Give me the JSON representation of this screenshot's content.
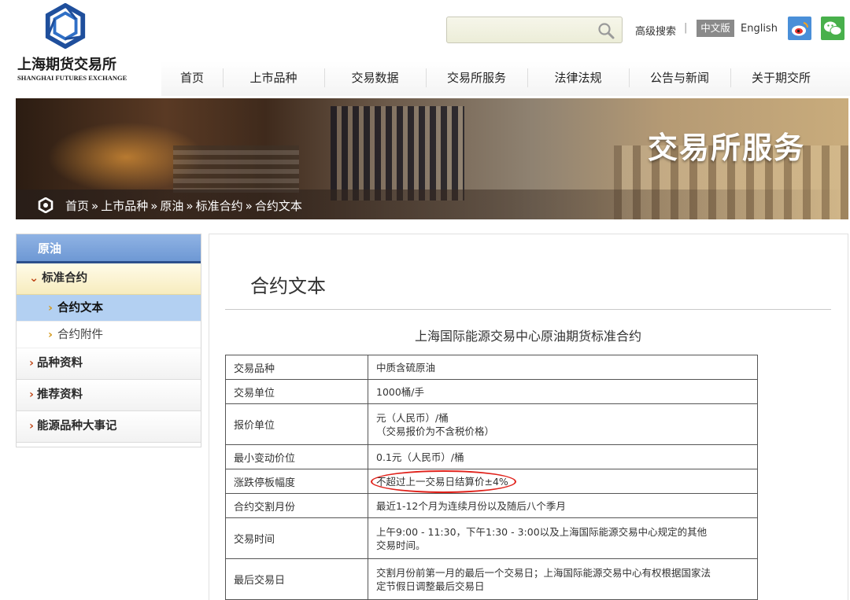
{
  "header": {
    "logo_cn": "上海期货交易所",
    "logo_en": "SHANGHAI FUTURES EXCHANGE",
    "search_placeholder": "",
    "advanced_search": "高级搜索",
    "separator": "|",
    "lang_cn": "中文版",
    "lang_en": "English"
  },
  "nav": [
    {
      "label": "首页"
    },
    {
      "label": "上市品种"
    },
    {
      "label": "交易数据"
    },
    {
      "label": "交易所服务"
    },
    {
      "label": "法律法规"
    },
    {
      "label": "公告与新闻"
    },
    {
      "label": "关于期交所"
    }
  ],
  "banner": {
    "title": "交易所服务",
    "breadcrumb": [
      "首页",
      "上市品种",
      "原油",
      "标准合约",
      "合约文本"
    ],
    "crumb_sep": "»"
  },
  "sidebar": {
    "head": "原油",
    "group": "标准合约",
    "group_chevron": "⌄",
    "subs": [
      {
        "label": "合约文本",
        "active": true
      },
      {
        "label": "合约附件",
        "active": false
      }
    ],
    "sub_chevron": "›",
    "items": [
      {
        "label": "品种资料"
      },
      {
        "label": "推荐资料"
      },
      {
        "label": "能源品种大事记"
      }
    ],
    "item_chevron": "›"
  },
  "main": {
    "title": "合约文本",
    "doc_title": "上海国际能源交易中心原油期货标准合约",
    "rows": [
      {
        "key": "交易品种",
        "value": [
          "中质含硫原油"
        ]
      },
      {
        "key": "交易单位",
        "value": [
          "1000桶/手"
        ]
      },
      {
        "key": "报价单位",
        "value": [
          "元（人民币）/桶",
          "（交易报价为不含税价格）"
        ]
      },
      {
        "key": "最小变动价位",
        "value": [
          "0.1元（人民币）/桶"
        ]
      },
      {
        "key": "涨跌停板幅度",
        "value": [
          "不超过上一交易日结算价±4%"
        ],
        "highlighted": true
      },
      {
        "key": "合约交割月份",
        "value": [
          "最近1-12个月为连续月份以及随后八个季月"
        ]
      },
      {
        "key": "交易时间",
        "value": [
          "上午9:00 - 11:30，下午1:30 - 3:00以及上海国际能源交易中心规定的其他",
          "交易时间。"
        ]
      },
      {
        "key": "最后交易日",
        "value": [
          "交割月份前第一月的最后一个交易日；上海国际能源交易中心有权根据国家法",
          "定节假日调整最后交易日"
        ]
      }
    ]
  },
  "colors": {
    "nav_active_blue": "#2c4f8c",
    "sidebar_active": "#b3d0f2",
    "highlight_ring": "#e0221b",
    "chevron": "#c04a1c"
  }
}
